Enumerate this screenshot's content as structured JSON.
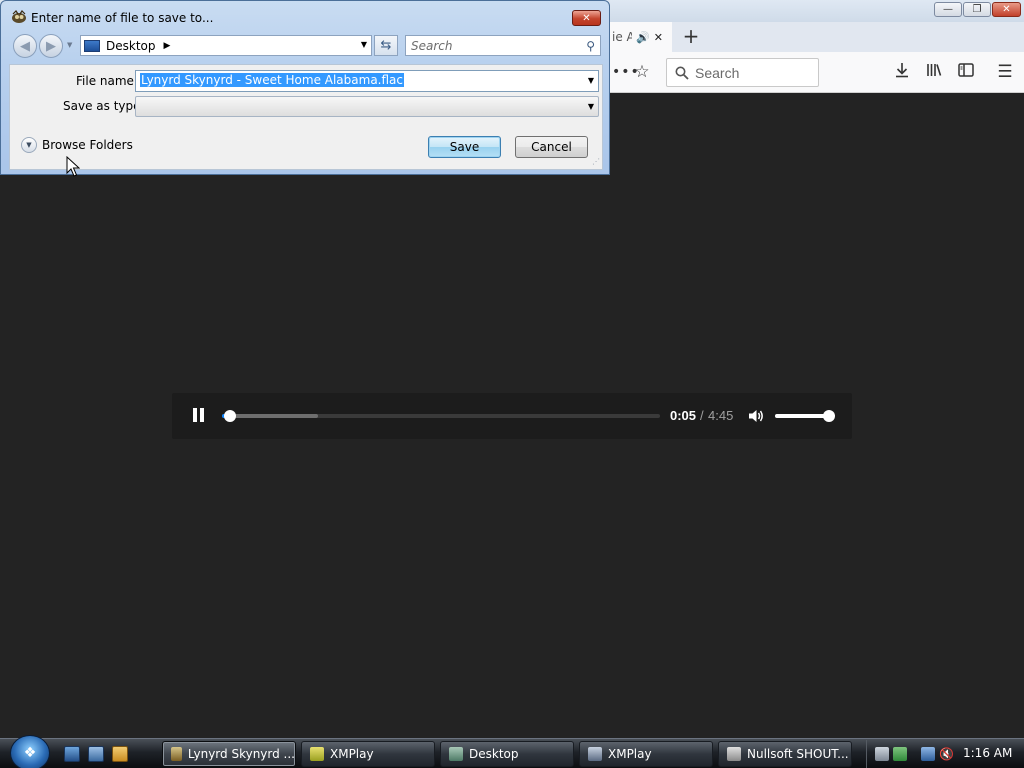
{
  "browser": {
    "tab_title": "ie A",
    "search_placeholder": "Search",
    "window_buttons": {
      "minimize": "—",
      "maximize": "❐",
      "close": "✕"
    },
    "icons": [
      "speaker-icon",
      "close-tab-icon",
      "new-tab-icon",
      "star-icon",
      "search-icon",
      "download-icon",
      "library-icon",
      "sidebar-icon",
      "menu-icon"
    ]
  },
  "media_player": {
    "current_time": "0:05",
    "separator": "/",
    "total_time": "4:45",
    "progress_fraction": 0.018,
    "buffered_fraction": 0.22,
    "volume_fraction": 1.0,
    "state": "playing",
    "accent_color": "#0a84ff"
  },
  "save_dialog": {
    "title": "Enter name of file to save to...",
    "address": "Desktop",
    "search_placeholder": "Search",
    "file_name_label": "File name:",
    "file_name_value": "Lynyrd Skynyrd - Sweet Home Alabama.flac",
    "save_as_type_label": "Save as type:",
    "save_as_type_value": "",
    "browse_folders_label": "Browse Folders",
    "save_label": "Save",
    "cancel_label": "Cancel",
    "close_label": "✕"
  },
  "taskbar": {
    "tasks": [
      {
        "label": "Lynyrd Skynyrd ...",
        "active": true
      },
      {
        "label": "XMPlay",
        "active": false
      },
      {
        "label": "Desktop",
        "active": false
      },
      {
        "label": "XMPlay",
        "active": false
      },
      {
        "label": "Nullsoft SHOUT...",
        "active": false
      }
    ],
    "clock": "1:16 AM"
  }
}
